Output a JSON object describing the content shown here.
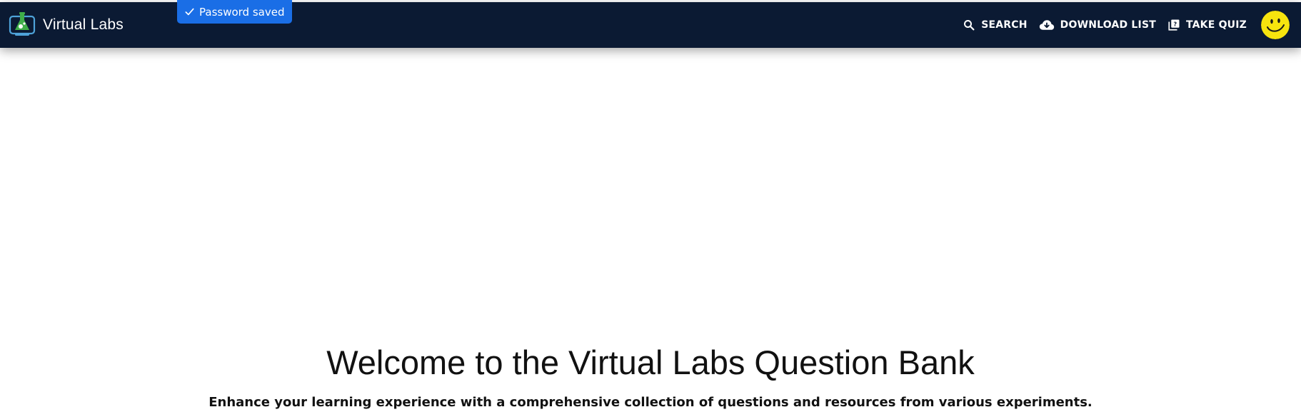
{
  "toast": {
    "text": "Password saved",
    "icon": "check-icon",
    "color": "#1a6ee6"
  },
  "navbar": {
    "brand_title": "Virtual Labs",
    "brand_icon": "flask-monitor-logo-icon",
    "background": "#0b1a33",
    "actions": [
      {
        "label": "SEARCH",
        "icon": "search-icon"
      },
      {
        "label": "DOWNLOAD LIST",
        "icon": "cloud-download-icon"
      },
      {
        "label": "TAKE QUIZ",
        "icon": "quiz-icon"
      }
    ],
    "avatar_icon": "smiley-avatar-icon",
    "avatar_color": "#f7e40e"
  },
  "hero": {
    "title": "Welcome to the Virtual Labs Question Bank",
    "subtitle": "Enhance your learning experience with a comprehensive collection of questions and resources from various experiments."
  }
}
